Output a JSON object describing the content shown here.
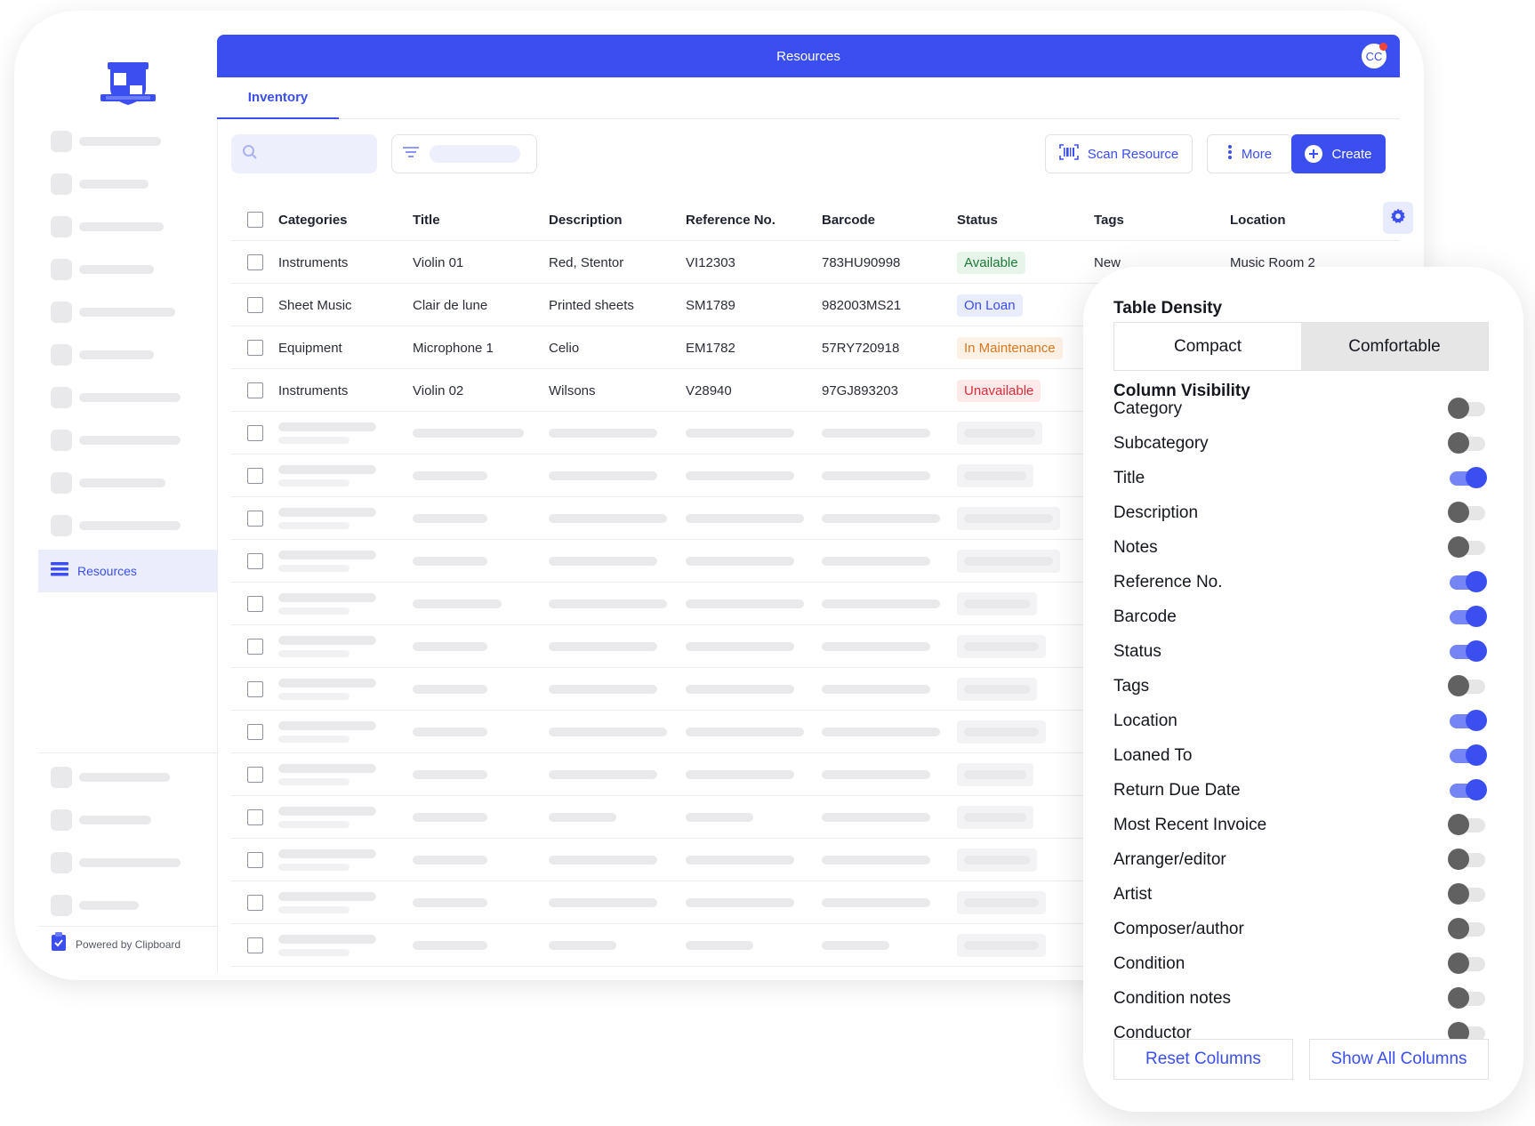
{
  "header": {
    "title": "Resources",
    "avatar_initials": "CC"
  },
  "tabs": [
    {
      "label": "Inventory",
      "active": true
    }
  ],
  "sidebar": {
    "active_item": {
      "label": "Resources",
      "icon": "list-icon"
    },
    "powered_by": "Powered by Clipboard"
  },
  "toolbar": {
    "scan_label": "Scan Resource",
    "more_label": "More",
    "create_label": "Create"
  },
  "table": {
    "columns": [
      "Categories",
      "Title",
      "Description",
      "Reference No.",
      "Barcode",
      "Status",
      "Tags",
      "Location"
    ],
    "rows": [
      {
        "category": "Instruments",
        "title": "Violin 01",
        "description": "Red, Stentor",
        "reference": "VI12303",
        "barcode": "783HU90998",
        "status": "Available",
        "tags": "New",
        "location": "Music Room 2"
      },
      {
        "category": "Sheet Music",
        "title": "Clair de lune",
        "description": "Printed sheets",
        "reference": "SM1789",
        "barcode": "982003MS21",
        "status": "On Loan",
        "tags": "",
        "location": ""
      },
      {
        "category": "Equipment",
        "title": "Microphone 1",
        "description": "Celio",
        "reference": "EM1782",
        "barcode": "57RY720918",
        "status": "In Maintenance",
        "tags": "",
        "location": ""
      },
      {
        "category": "Instruments",
        "title": "Violin 02",
        "description": "Wilsons",
        "reference": "V28940",
        "barcode": "97GJ893203",
        "status": "Unavailable",
        "tags": "",
        "location": ""
      }
    ]
  },
  "settings_panel": {
    "density_heading": "Table Density",
    "density_options": [
      {
        "label": "Compact",
        "selected": false
      },
      {
        "label": "Comfortable",
        "selected": true
      }
    ],
    "visibility_heading": "Column Visibility",
    "columns": [
      {
        "label": "Category",
        "on": false
      },
      {
        "label": "Subcategory",
        "on": false
      },
      {
        "label": "Title",
        "on": true
      },
      {
        "label": "Description",
        "on": false
      },
      {
        "label": "Notes",
        "on": false
      },
      {
        "label": "Reference No.",
        "on": true
      },
      {
        "label": "Barcode",
        "on": true
      },
      {
        "label": "Status",
        "on": true
      },
      {
        "label": "Tags",
        "on": false
      },
      {
        "label": "Location",
        "on": true
      },
      {
        "label": "Loaned To",
        "on": true
      },
      {
        "label": "Return Due Date",
        "on": true
      },
      {
        "label": "Most Recent Invoice",
        "on": false
      },
      {
        "label": "Arranger/editor",
        "on": false
      },
      {
        "label": "Artist",
        "on": false
      },
      {
        "label": "Composer/author",
        "on": false
      },
      {
        "label": "Condition",
        "on": false
      },
      {
        "label": "Condition notes",
        "on": false
      },
      {
        "label": "Conductor",
        "on": false
      }
    ],
    "reset_label": "Reset Columns",
    "show_all_label": "Show All Columns"
  },
  "colors": {
    "accent": "#3b4ef0",
    "available": "#1e7a36",
    "on_loan": "#3b4ef0",
    "maintenance": "#d7771f",
    "unavailable": "#d92d3a"
  }
}
